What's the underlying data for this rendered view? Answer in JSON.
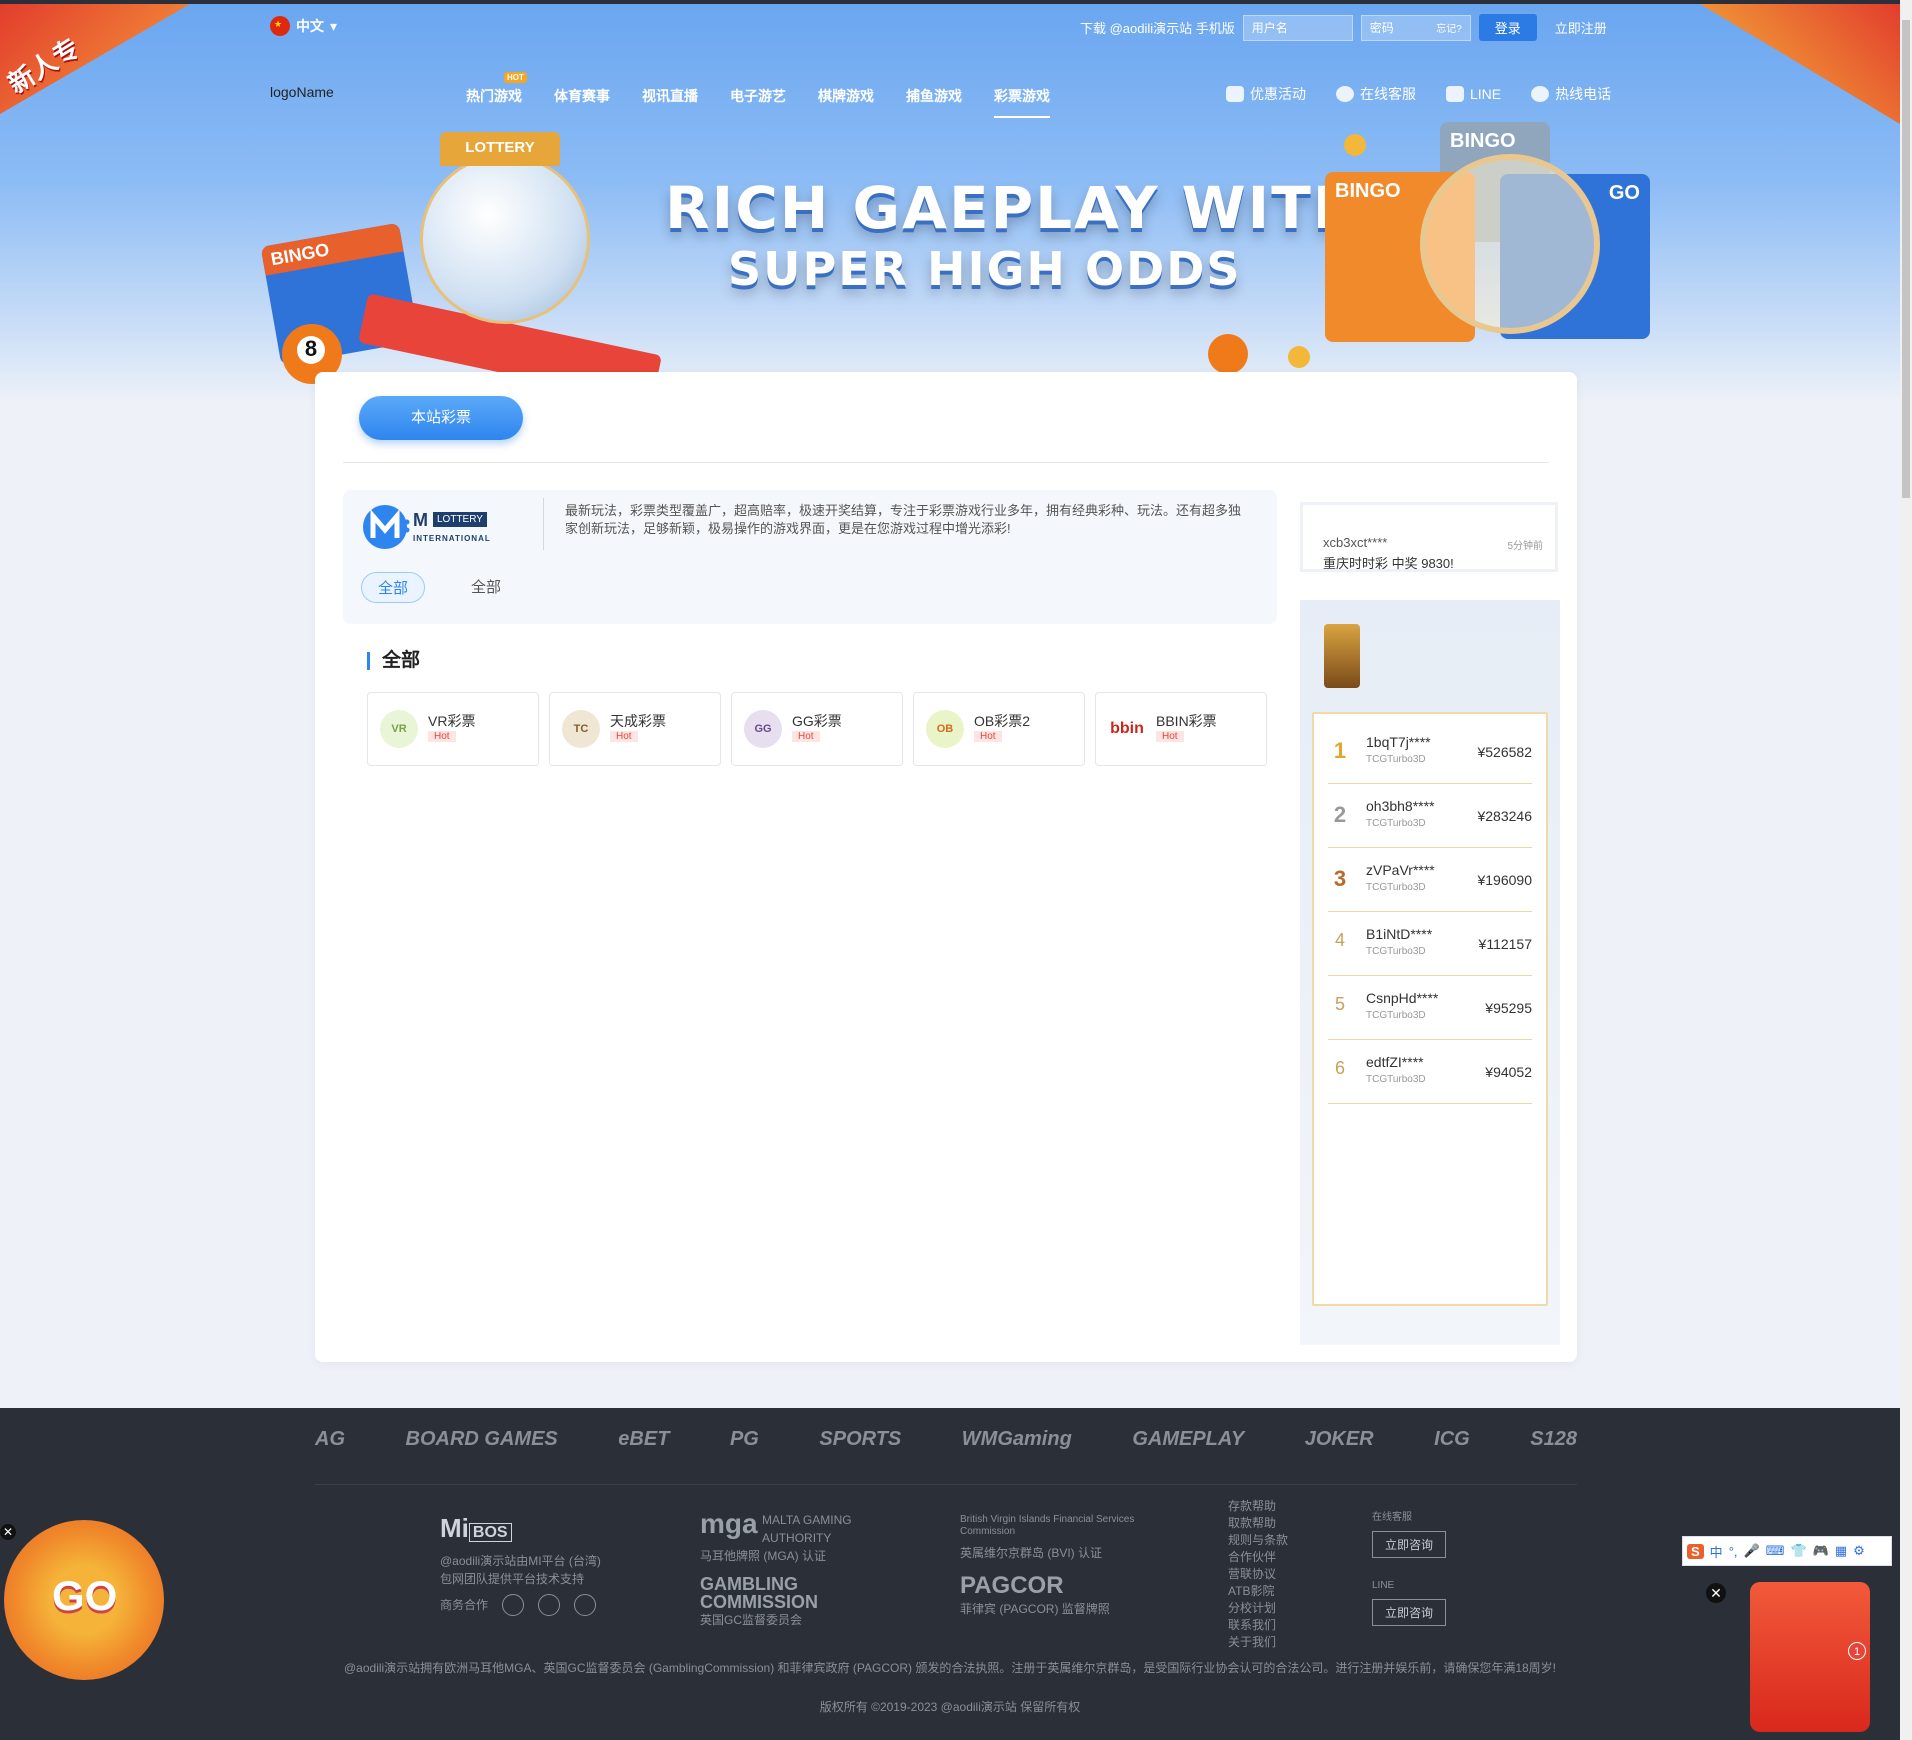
{
  "promo_corner": "新人专",
  "header": {
    "language": "中文",
    "download_label": "下载 @aodili演示站 手机版",
    "username_placeholder": "用户名",
    "password_placeholder": "密码",
    "forgot_label": "忘记?",
    "login_label": "登录",
    "register_label": "立即注册"
  },
  "nav": {
    "logo_alt": "logoName",
    "items": [
      "热门游戏",
      "体育赛事",
      "视讯直播",
      "电子游艺",
      "棋牌游戏",
      "捕鱼游戏",
      "彩票游戏"
    ],
    "hot_badge": "HOT",
    "active_index": 6,
    "quick": [
      "优惠活动",
      "在线客服",
      "LINE",
      "热线电话"
    ]
  },
  "banner": {
    "line1": "RICH GAEPLAY WITH",
    "line2": "SUPER HIGH ODDS",
    "lottery_sign": "LOTTERY",
    "bingo_labels": [
      "BINGO",
      "BINGO",
      "BINGO",
      "GO"
    ],
    "ball_number": "8"
  },
  "main": {
    "pill_label": "本站彩票",
    "provider": {
      "m": "M",
      "lottery": "LOTTERY",
      "intl": "INTERNATIONAL"
    },
    "description": "最新玩法，彩票类型覆盖广，超高赔率，极速开奖结算，专注于彩票游戏行业多年，拥有经典彩种、玩法。还有超多独家创新玩法，足够新颖，极易操作的游戏界面，更是在您游戏过程中增光添彩!",
    "tabs": [
      "全部",
      "全部"
    ],
    "section_title": "全部",
    "games": [
      {
        "name": "VR彩票",
        "hot": "Hot",
        "icon": "VR",
        "color": "#e9f5d7"
      },
      {
        "name": "天成彩票",
        "hot": "Hot",
        "icon": "TC",
        "color": "#f0e6d4"
      },
      {
        "name": "GG彩票",
        "hot": "Hot",
        "icon": "GG",
        "color": "#e7dff0"
      },
      {
        "name": "OB彩票2",
        "hot": "Hot",
        "icon": "OB",
        "color": "#e9f5c8"
      },
      {
        "name": "BBIN彩票",
        "hot": "Hot",
        "icon": "bbin",
        "color": "#fff"
      }
    ]
  },
  "ticker": {
    "user": "xcb3xct****",
    "time": "5分钟前",
    "message": "重庆时时彩 中奖 9830!"
  },
  "ranking": [
    {
      "rank": "1",
      "name": "1bqT7j****",
      "game": "TCGTurbo3D",
      "amount": "¥526582"
    },
    {
      "rank": "2",
      "name": "oh3bh8****",
      "game": "TCGTurbo3D",
      "amount": "¥283246"
    },
    {
      "rank": "3",
      "name": "zVPaVr****",
      "game": "TCGTurbo3D",
      "amount": "¥196090"
    },
    {
      "rank": "4",
      "name": "B1iNtD****",
      "game": "TCGTurbo3D",
      "amount": "¥112157"
    },
    {
      "rank": "5",
      "name": "CsnpHd****",
      "game": "TCGTurbo3D",
      "amount": "¥95295"
    },
    {
      "rank": "6",
      "name": "edtfZI****",
      "game": "TCGTurbo3D",
      "amount": "¥94052"
    }
  ],
  "footer": {
    "partners": [
      "AG",
      "BOARD GAMES",
      "eBET",
      "PG",
      "SPORTS",
      "WMGaming",
      "GAMEPLAY",
      "JOKER",
      "ICG",
      "S128"
    ],
    "mibos": {
      "logo": "Mi",
      "logo_box": "BOS",
      "line1": "@aodili演示站由MI平台 (台湾)",
      "line2": "包网团队提供平台技术支持",
      "biz": "商务合作"
    },
    "mga": {
      "logo": "mga",
      "sub": "MALTA GAMING AUTHORITY",
      "caption": "马耳他牌照 (MGA) 认证"
    },
    "gc": {
      "logo": "GAMBLING COMMISSION",
      "caption": "英国GC监督委员会"
    },
    "bvi": {
      "logo": "British Virgin Islands Financial Services Commission",
      "caption": "英属维尔京群岛 (BVI) 认证"
    },
    "pagcor": {
      "logo": "PAGCOR",
      "caption": "菲律宾 (PAGCOR) 监督牌照"
    },
    "links": [
      "存款帮助",
      "取款帮助",
      "规则与条款",
      "合作伙伴",
      "营联协议",
      "ATB影院",
      "分校计划",
      "联系我们",
      "关于我们"
    ],
    "service": [
      {
        "label": "在线客服",
        "button": "立即咨询"
      },
      {
        "label": "LINE",
        "button": "立即咨询"
      }
    ],
    "legal": "@aodili演示站拥有欧洲马耳他MGA、英国GC监督委员会 (GamblingCommission) 和菲律宾政府 (PAGCOR) 颁发的合法执照。注册于英属维尔京群岛，是受国际行业协会认可的合法公司。进行注册并娱乐前，请确保您年满18周岁!",
    "copyright": "版权所有 ©2019-2023 @aodili演示站 保留所有权"
  },
  "floating": {
    "wheel_label": "GO",
    "close": "✕",
    "ime": [
      "S",
      "中",
      "°,",
      "🎤",
      "⌨",
      "👕",
      "🎮",
      "▦",
      "⚙"
    ],
    "badge": "1"
  }
}
